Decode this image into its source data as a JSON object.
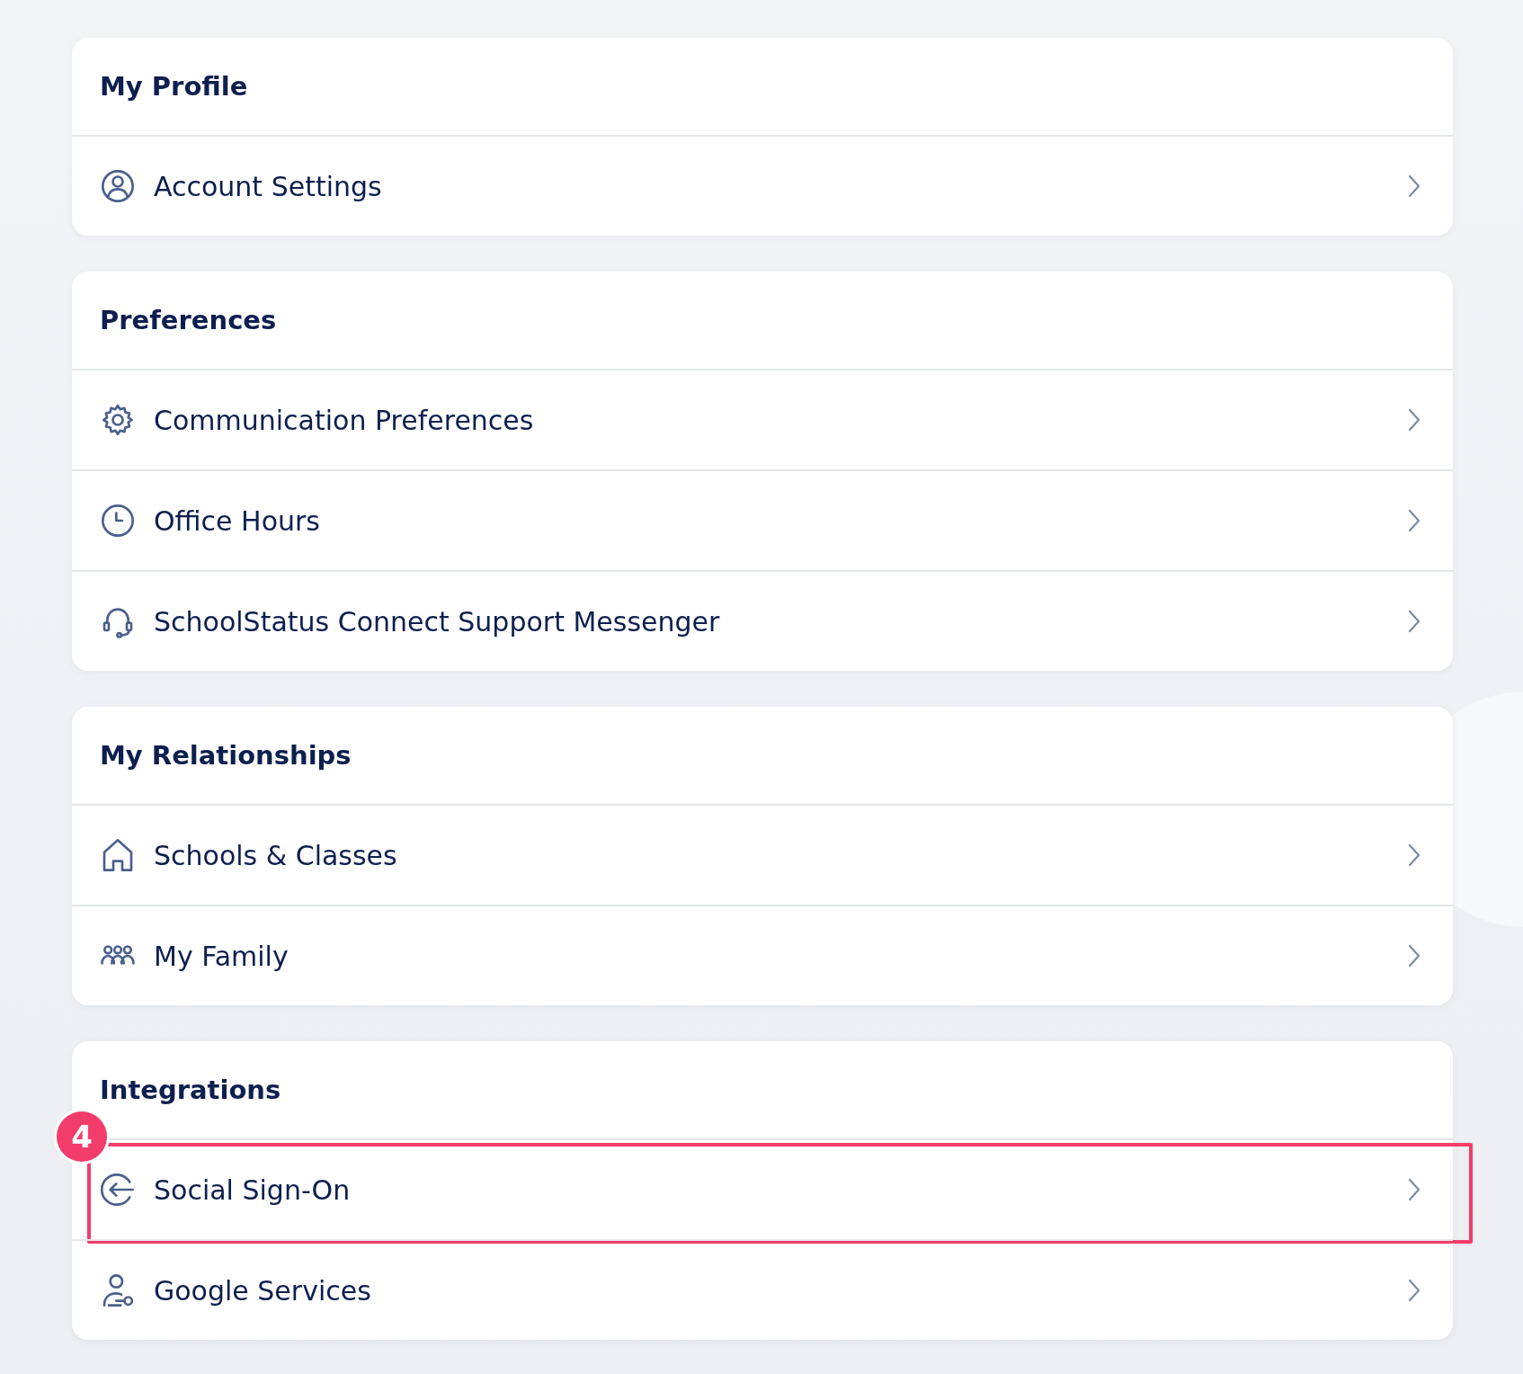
{
  "sections": [
    {
      "title": "My Profile",
      "items": [
        {
          "label": "Account Settings",
          "kind": "user",
          "highlighted": false
        }
      ]
    },
    {
      "title": "Preferences",
      "items": [
        {
          "label": "Communication Preferences",
          "kind": "gear",
          "highlighted": false
        },
        {
          "label": "Office Hours",
          "kind": "clock",
          "highlighted": false
        },
        {
          "label": "SchoolStatus Connect Support Messenger",
          "kind": "headset",
          "highlighted": false
        }
      ]
    },
    {
      "title": "My Relationships",
      "items": [
        {
          "label": "Schools & Classes",
          "kind": "house",
          "highlighted": false
        },
        {
          "label": "My Family",
          "kind": "family",
          "highlighted": false
        }
      ]
    },
    {
      "title": "Integrations",
      "items": [
        {
          "label": "Social Sign-On",
          "kind": "signin",
          "highlighted": true,
          "badge": "4"
        },
        {
          "label": "Google Services",
          "kind": "userkey",
          "highlighted": false
        }
      ]
    }
  ]
}
